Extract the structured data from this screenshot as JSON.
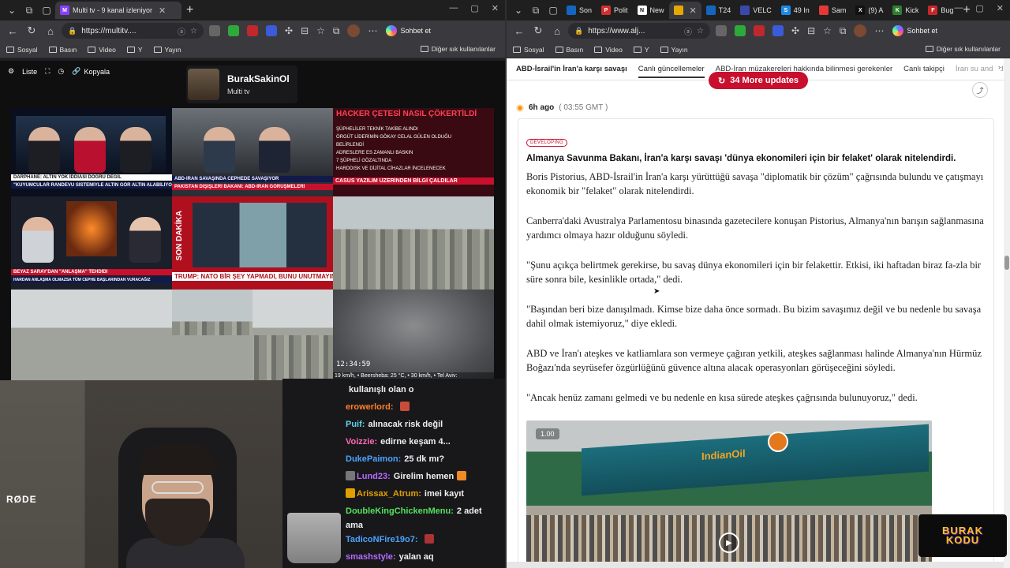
{
  "left_window": {
    "tabs": [
      {
        "label": "Multi tv - 9 kanal izleniyor",
        "active": true
      }
    ],
    "address": "https://multitv....",
    "bookmarks": [
      "Sosyal",
      "Basın",
      "Video",
      "Y",
      "Yayın"
    ],
    "bookmarks_right": "Diğer sık kullanılanlar",
    "sohbet": "Sohbet et",
    "multitv": {
      "toolbar": {
        "list": "Liste",
        "copy": "Kopyala"
      },
      "profile_name": "BurakSakinOl",
      "profile_sub": "Multi tv",
      "tiles": [
        {
          "band": "DARPHANE: ALTIN YOK İDDİASI DOĞRU DEĞİL",
          "sub": "\"KUYUMCULAR RANDEVU SİSTEMİYLE ALTIN GÖR ALTIN ALABİLİYOR\""
        },
        {
          "band": "PAKİSTAN DIŞİŞLERİ BAKANI: ABD-İRAN GÖRÜŞMELERİ",
          "sub": "ABD-İRAN SAVAŞINDA CEPHEDE SAVAŞIYOR"
        },
        {
          "band": "CASUS YAZILIM ÜZERİNDEN BİLGİ ÇALDILAR",
          "head": "HACKER ÇETESİ NASIL ÇÖKERTİLDİ",
          "lines": [
            "ŞÜPHELİLER TEKNİK TAKİBE ALINDI",
            "ÖRGÜT LİDERİMİN GÖKAY CELAL GÜLEN OLDUĞU BELİRLENDİ",
            "ADRESLERE ES ZAMANLI BASKIN",
            "7 ŞÜPHELİ GÖZALTINDA",
            "HARDDISK VE DİJİTAL CİHAZLAR İNCELENECEK"
          ]
        },
        {
          "band": "BEYAZ SARAY'DAN \"ANLAŞMA\" TEHDİDİ",
          "sub": "HARDAN ANLAŞMA OLMAZSA TÜM CEPHE BAŞLARINDAN VURACAĞIZ"
        },
        {
          "band": "TRUMP: NATO BİR ŞEY YAPMADI, BUNU UNUTMAYIN",
          "tag": "SON DAKİKA"
        },
        {
          "band": ""
        },
        {
          "band": ""
        },
        {
          "band": ""
        },
        {
          "time": "12:34:59",
          "weather": "19 km/h, • Beersheba: 25 °C, • 30 km/h, • Tel Aviv:"
        }
      ]
    },
    "webcam_logo": "RØDE",
    "chat": [
      {
        "user": "",
        "msg": "kullanışlı olan o",
        "color": "#efeff1"
      },
      {
        "user": "erowerlord:",
        "msg": "",
        "color": "#ff7f27",
        "emote": "#c94b3a"
      },
      {
        "user": "Puif:",
        "msg": "alınacak risk değil",
        "color": "#5fd4e6"
      },
      {
        "user": "Voizzie:",
        "msg": "edirne keşam 4...",
        "color": "#ff69b4"
      },
      {
        "user": "DukePaimon:",
        "msg": "25 dk mı?",
        "color": "#4aa3ff"
      },
      {
        "user": "Lund23:",
        "msg": "Girelim hemen",
        "color": "#b66bff",
        "emote": "#f08a24"
      },
      {
        "user": "Arissax_Atrum:",
        "msg": "imei kayıt",
        "color": "#e0a000"
      },
      {
        "user": "DoubleKingChickenMenu:",
        "msg": "2 adet",
        "color": "#54e35a"
      },
      {
        "user": "",
        "msg": "ama",
        "color": "#efeff1"
      },
      {
        "user": "TadicoNFire19o7:",
        "msg": "",
        "color": "#4aa3ff",
        "emote": "#a33"
      },
      {
        "user": "smashstyle:",
        "msg": "yalan aq",
        "color": "#b66bff"
      }
    ]
  },
  "right_window": {
    "tabs": [
      "Son",
      "Polit",
      "New",
      "",
      "T24",
      "VELC",
      "49 In",
      "Sam",
      "(9) A",
      "Kick",
      "Bug"
    ],
    "address": "https://www.alj...",
    "bookmarks": [
      "Sosyal",
      "Basın",
      "Video",
      "Y",
      "Yayın"
    ],
    "bookmarks_right": "Diğer sık kullanılanlar",
    "sohbet": "Sohbet et",
    "article": {
      "subnav": [
        "ABD-İsrail'in İran'a karşı savaşı",
        "Canlı güncellemeler",
        "ABD-İran müzakereleri hakkında bilinmesi gerekenler",
        "Canlı takipçi",
        "İran su anda dah"
      ],
      "more_updates": "34 More updates",
      "time_ago": "6h ago",
      "time_gmt": "( 03:55 GMT )",
      "badge": "DEVELOPING",
      "headline": "Almanya Savunma Bakanı, İran'a karşı savaşı 'dünya ekonomileri için bir felaket' olarak nitelendirdi.",
      "paragraphs": [
        "Boris Pistorius, ABD-İsrail'in İran'a karşı yürüttüğü savaşa \"diplomatik bir çözüm\" çağrısında bulundu ve çatışmayı ekonomik bir \"felaket\" olarak nitelendirdi.",
        "Canberra'daki Avustralya Parlamentosu binasında gazetecilere konuşan Pistorius, Almanya'nın barışın sağlanmasına yardımcı olmaya hazır olduğunu söyledi.",
        "\"Şunu açıkça belirtmek gerekirse, bu savaş dünya ekonomileri için bir felakettir. Etkisi, iki haftadan biraz fa-zla bir süre sonra bile, kesinlikle ortada,\" dedi.",
        "\"Başından beri bize danışılmadı. Kimse bize daha önce sormadı. Bu bizim savaşımız değil ve bu nedenle bu savaşa dahil olmak istemiyoruz,\" diye ekledi.",
        "ABD ve İran'ı ateşkes ve katliamlara son vermeye çağıran yetkili, ateşkes sağlanması halinde Almanya'nın Hürmüz Boğazı'nda seyrüsefer özgürlüğünü güvence altına alacak operasyonları görüşeceğini söyledi.",
        "\"Ancak henüz zamanı gelmedi ve bu nedenle en kısa sürede ateşkes çağrısında bulunuyoruz,\" dedi."
      ],
      "photo_pill": "1.00",
      "photo_brand": "IndianOil"
    },
    "overlay_logo": [
      "BURAK",
      "KODU"
    ]
  }
}
